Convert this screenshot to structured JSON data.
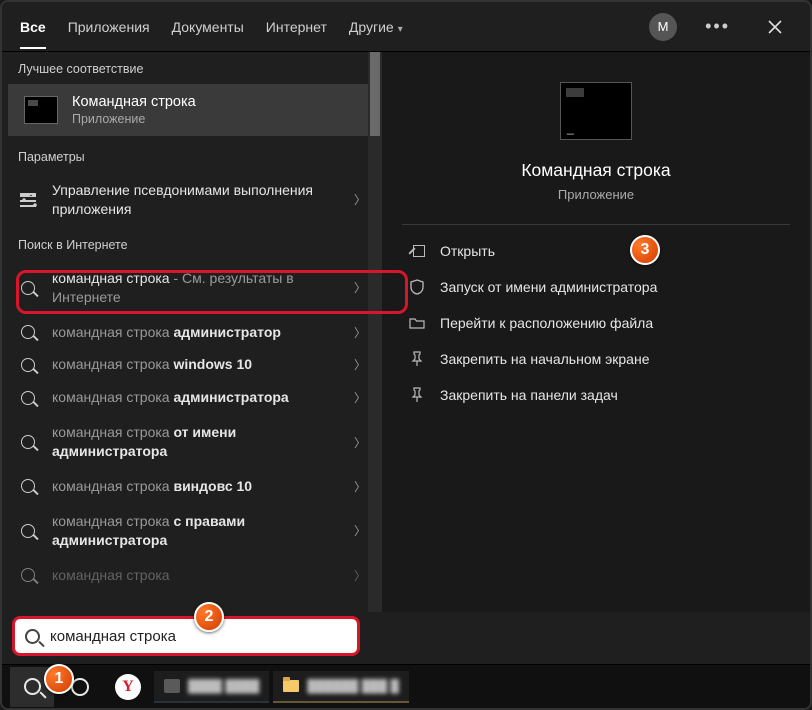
{
  "tabs": {
    "all": "Все",
    "apps": "Приложения",
    "docs": "Документы",
    "internet": "Интернет",
    "more": "Другие"
  },
  "avatar_letter": "M",
  "left": {
    "best_match_label": "Лучшее соответствие",
    "best_match": {
      "title": "Командная строка",
      "subtitle": "Приложение"
    },
    "settings_label": "Параметры",
    "settings_item": "Управление псевдонимами выполнения приложения",
    "web_label": "Поиск в Интернете",
    "web_items": [
      {
        "prefix": "командная строка",
        "suffix": " - См. результаты в Интернете",
        "bold": ""
      },
      {
        "prefix": "командная строка ",
        "bold": "администратор",
        "suffix": ""
      },
      {
        "prefix": "командная строка ",
        "bold": "windows 10",
        "suffix": ""
      },
      {
        "prefix": "командная строка ",
        "bold": "администратора",
        "suffix": ""
      },
      {
        "prefix": "командная строка ",
        "bold": "от имени администратора",
        "suffix": ""
      },
      {
        "prefix": "командная строка ",
        "bold": "виндовс 10",
        "suffix": ""
      },
      {
        "prefix": "командная строка ",
        "bold": "с правами администратора",
        "suffix": ""
      },
      {
        "prefix": "командная строка",
        "bold": "",
        "suffix": ""
      }
    ]
  },
  "right": {
    "title": "Командная строка",
    "subtitle": "Приложение",
    "actions": {
      "open": "Открыть",
      "run_admin": "Запуск от имени администратора",
      "open_location": "Перейти к расположению файла",
      "pin_start": "Закрепить на начальном экране",
      "pin_taskbar": "Закрепить на панели задач"
    }
  },
  "search_value": "командная строка",
  "badges": {
    "b1": "1",
    "b2": "2",
    "b3": "3"
  }
}
